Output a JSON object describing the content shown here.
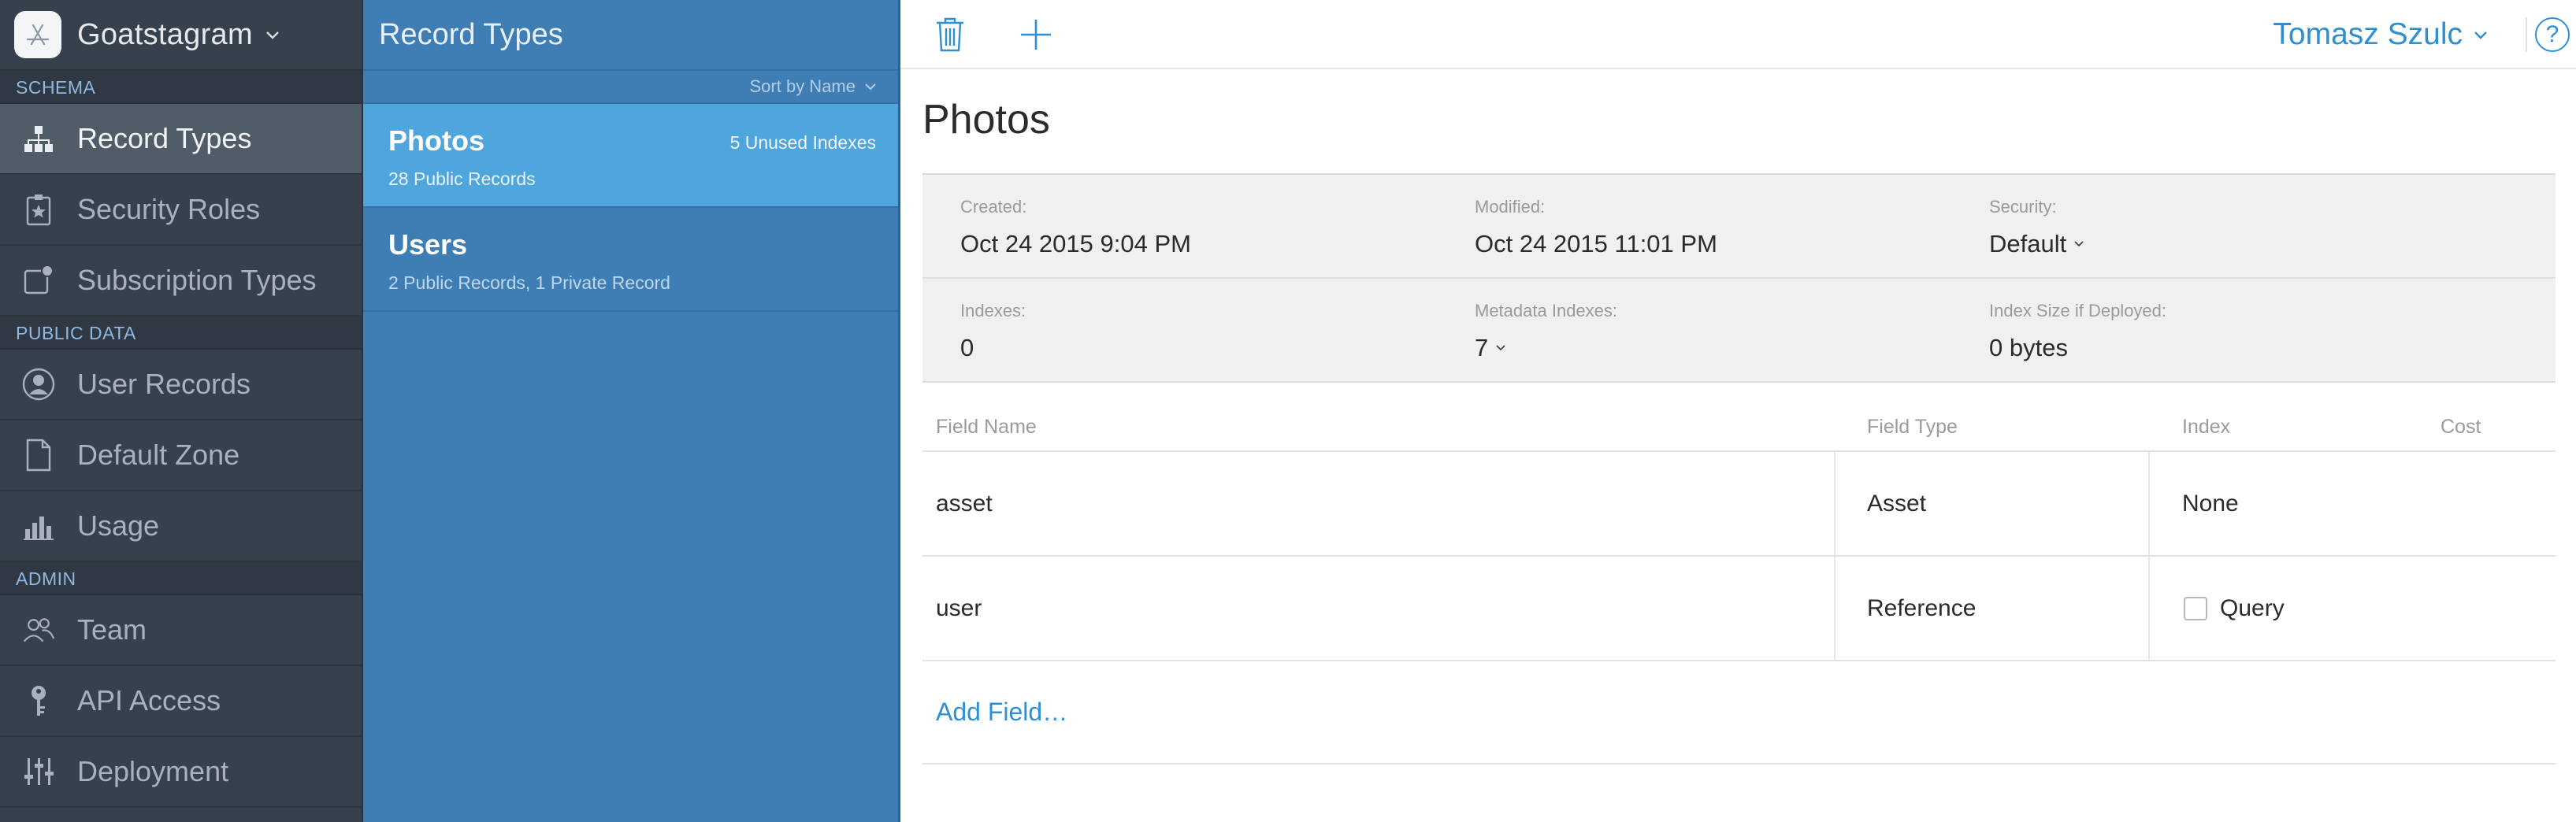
{
  "app": {
    "name": "Goatstagram"
  },
  "sidebar": {
    "sections": [
      {
        "label": "SCHEMA",
        "items": [
          {
            "label": "Record Types",
            "icon": "hierarchy-icon",
            "active": true
          },
          {
            "label": "Security Roles",
            "icon": "badge-star-icon"
          },
          {
            "label": "Subscription Types",
            "icon": "subscription-icon"
          }
        ]
      },
      {
        "label": "PUBLIC DATA",
        "items": [
          {
            "label": "User Records",
            "icon": "user-icon"
          },
          {
            "label": "Default Zone",
            "icon": "document-icon"
          },
          {
            "label": "Usage",
            "icon": "bar-chart-icon"
          }
        ]
      },
      {
        "label": "ADMIN",
        "items": [
          {
            "label": "Team",
            "icon": "team-icon"
          },
          {
            "label": "API Access",
            "icon": "key-icon"
          },
          {
            "label": "Deployment",
            "icon": "sliders-icon"
          }
        ]
      }
    ]
  },
  "list": {
    "title": "Record Types",
    "sort_label": "Sort by Name",
    "items": [
      {
        "name": "Photos",
        "subtitle": "28 Public Records",
        "badge": "5 Unused Indexes",
        "selected": true
      },
      {
        "name": "Users",
        "subtitle": "2 Public Records, 1 Private Record",
        "badge": ""
      }
    ]
  },
  "toolbar": {
    "user_name": "Tomasz Szulc",
    "help_label": "?"
  },
  "detail": {
    "title": "Photos",
    "info": {
      "created_label": "Created:",
      "created_value": "Oct 24 2015 9:04 PM",
      "modified_label": "Modified:",
      "modified_value": "Oct 24 2015 11:01 PM",
      "security_label": "Security:",
      "security_value": "Default",
      "indexes_label": "Indexes:",
      "indexes_value": "0",
      "metadata_label": "Metadata Indexes:",
      "metadata_value": "7",
      "size_label": "Index Size if Deployed:",
      "size_value": "0 bytes"
    },
    "fields_table": {
      "headers": {
        "name": "Field Name",
        "type": "Field Type",
        "index": "Index",
        "cost": "Cost"
      },
      "rows": [
        {
          "name": "asset",
          "type": "Asset",
          "index": "None"
        },
        {
          "name": "user",
          "type": "Reference",
          "index": "Query"
        }
      ],
      "add_label": "Add Field…"
    }
  },
  "colors": {
    "accent": "#2e8fd4",
    "sidebar_bg": "#37414d",
    "list_bg": "#3f7db5",
    "selected_bg": "#4fa6dd"
  }
}
